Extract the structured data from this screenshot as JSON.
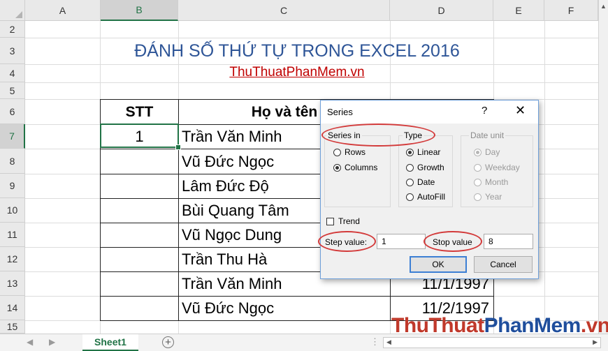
{
  "columns": [
    "A",
    "B",
    "C",
    "D",
    "E",
    "F"
  ],
  "rows": [
    "2",
    "3",
    "4",
    "5",
    "6",
    "7",
    "8",
    "9",
    "10",
    "11",
    "12",
    "13",
    "14",
    "15"
  ],
  "sheet": {
    "title": "ĐÁNH SỐ THỨ TỰ TRONG EXCEL 2016",
    "subtitle": "ThuThuatPhanMem.vn",
    "header_stt": "STT",
    "header_name": "Họ và tên",
    "stt_values": [
      "1",
      "",
      "",
      "",
      "",
      "",
      "",
      ""
    ],
    "names": [
      "Trần Văn Minh",
      "Vũ Đức Ngọc",
      "Lâm Đức Độ",
      "Bùi Quang Tâm",
      "Vũ Ngọc Dung",
      "Trần Thu Hà",
      "Trần Văn Minh",
      "Vũ Đức Ngọc"
    ],
    "dates": [
      "11/1/1997",
      "11/2/1997"
    ]
  },
  "dialog": {
    "title": "Series",
    "help": "?",
    "close": "✕",
    "series_in": {
      "label": "Series in",
      "rows": "Rows",
      "columns": "Columns",
      "selected": "Columns"
    },
    "type": {
      "label": "Type",
      "linear": "Linear",
      "growth": "Growth",
      "date": "Date",
      "autofill": "AutoFill",
      "selected": "Linear"
    },
    "date_unit": {
      "label": "Date unit",
      "day": "Day",
      "weekday": "Weekday",
      "month": "Month",
      "year": "Year",
      "selected": "Day"
    },
    "trend": "Trend",
    "step_label": "Step value:",
    "step_value": "1",
    "stop_label": "Stop value",
    "stop_value": "8",
    "ok": "OK",
    "cancel": "Cancel"
  },
  "tabs": {
    "sheet1": "Sheet1",
    "add": "+"
  },
  "watermark": {
    "part1": "ThuThuat",
    "part2": "PhanMem",
    "part3": ".vn"
  },
  "colors": {
    "accent": "#217346",
    "title_blue": "#2e5597",
    "link_red": "#c00000",
    "highlight_ring": "#d33a3a"
  }
}
